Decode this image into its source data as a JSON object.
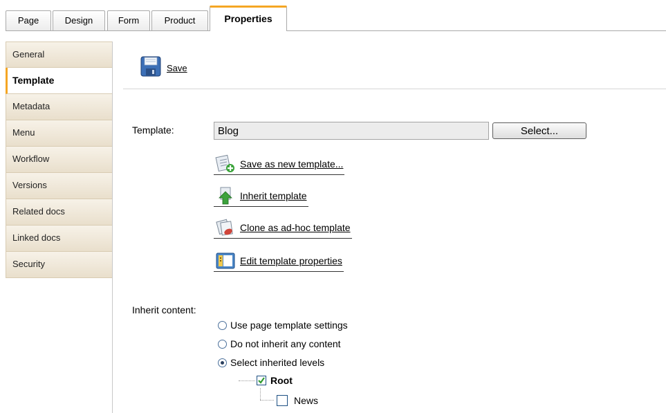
{
  "top_tabs": [
    {
      "label": "Page"
    },
    {
      "label": "Design"
    },
    {
      "label": "Form"
    },
    {
      "label": "Product"
    },
    {
      "label": "Properties"
    }
  ],
  "active_top_tab": "Properties",
  "sidebar": {
    "items": [
      {
        "label": "General"
      },
      {
        "label": "Template"
      },
      {
        "label": "Metadata"
      },
      {
        "label": "Menu"
      },
      {
        "label": "Workflow"
      },
      {
        "label": "Versions"
      },
      {
        "label": "Related docs"
      },
      {
        "label": "Linked docs"
      },
      {
        "label": "Security"
      }
    ],
    "active": "Template"
  },
  "toolbar": {
    "save_label": "Save"
  },
  "template": {
    "label": "Template:",
    "value": "Blog",
    "select_label": "Select..."
  },
  "actions": {
    "save_as_new": "Save as new template...",
    "inherit": "Inherit template",
    "clone": "Clone as ad-hoc template",
    "edit_properties": "Edit template properties"
  },
  "inherit_content": {
    "label": "Inherit content:",
    "options": [
      {
        "label": "Use page template settings",
        "checked": false
      },
      {
        "label": "Do not inherit any content",
        "checked": false
      },
      {
        "label": "Select inherited levels",
        "checked": true
      }
    ],
    "tree": [
      {
        "label": "Root",
        "checked": true
      },
      {
        "label": "News",
        "checked": false
      }
    ]
  },
  "colors": {
    "accent": "#f5a623",
    "sidebar_bg": "#e9dfcc",
    "checkbox_check": "#2e9a2e"
  },
  "icons": {
    "save": "floppy-disk-icon",
    "save_as_new": "document-add-icon",
    "inherit": "green-arrow-up-icon",
    "clone": "document-clone-icon",
    "edit_properties": "properties-panel-icon"
  }
}
